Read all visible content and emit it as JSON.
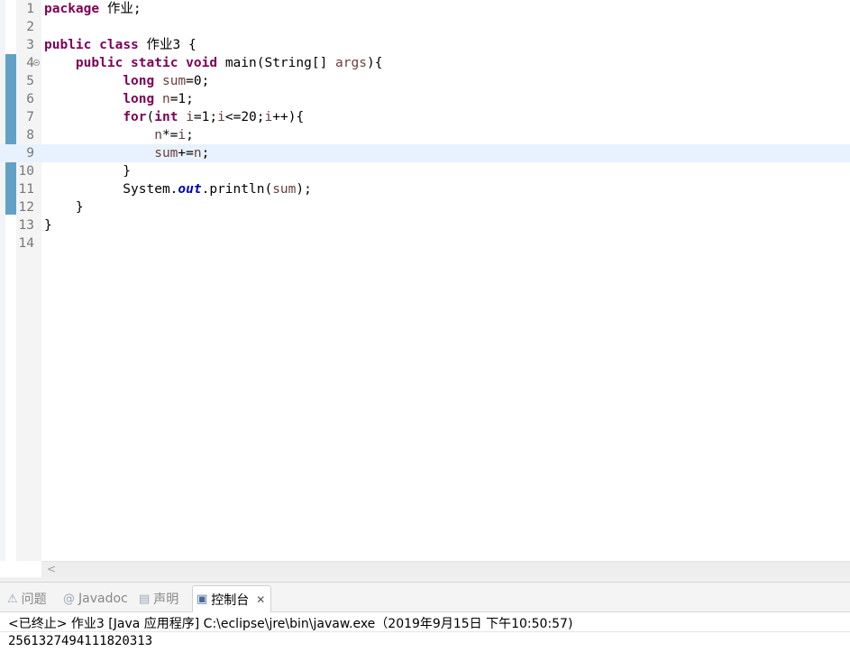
{
  "editor": {
    "current_line": 9,
    "lines": [
      {
        "n": "1",
        "tokens": [
          {
            "t": "package",
            "c": "kw"
          },
          {
            "t": " "
          },
          {
            "t": "作业",
            "c": "cjk"
          },
          {
            "t": ";"
          }
        ]
      },
      {
        "n": "2",
        "tokens": []
      },
      {
        "n": "3",
        "tokens": [
          {
            "t": "public",
            "c": "kw"
          },
          {
            "t": " "
          },
          {
            "t": "class",
            "c": "kw"
          },
          {
            "t": " "
          },
          {
            "t": "作业",
            "c": "cjk"
          },
          {
            "t": "3 {"
          }
        ]
      },
      {
        "n": "4",
        "fold": true,
        "tokens": [
          {
            "t": "    "
          },
          {
            "t": "public",
            "c": "kw"
          },
          {
            "t": " "
          },
          {
            "t": "static",
            "c": "kw"
          },
          {
            "t": " "
          },
          {
            "t": "void",
            "c": "kw"
          },
          {
            "t": " main(String[] "
          },
          {
            "t": "args",
            "c": "var"
          },
          {
            "t": "){"
          }
        ]
      },
      {
        "n": "5",
        "tokens": [
          {
            "t": "          "
          },
          {
            "t": "long",
            "c": "kw"
          },
          {
            "t": " "
          },
          {
            "t": "sum",
            "c": "var"
          },
          {
            "t": "=0;"
          }
        ]
      },
      {
        "n": "6",
        "tokens": [
          {
            "t": "          "
          },
          {
            "t": "long",
            "c": "kw"
          },
          {
            "t": " "
          },
          {
            "t": "n",
            "c": "var"
          },
          {
            "t": "=1;"
          }
        ]
      },
      {
        "n": "7",
        "tokens": [
          {
            "t": "          "
          },
          {
            "t": "for",
            "c": "kw"
          },
          {
            "t": "("
          },
          {
            "t": "int",
            "c": "kw"
          },
          {
            "t": " "
          },
          {
            "t": "i",
            "c": "var"
          },
          {
            "t": "=1;"
          },
          {
            "t": "i",
            "c": "var"
          },
          {
            "t": "<=20;"
          },
          {
            "t": "i",
            "c": "var"
          },
          {
            "t": "++){"
          }
        ]
      },
      {
        "n": "8",
        "tokens": [
          {
            "t": "              "
          },
          {
            "t": "n",
            "c": "var"
          },
          {
            "t": "*="
          },
          {
            "t": "i",
            "c": "var"
          },
          {
            "t": ";"
          }
        ]
      },
      {
        "n": "9",
        "tokens": [
          {
            "t": "              "
          },
          {
            "t": "sum",
            "c": "var"
          },
          {
            "t": "+="
          },
          {
            "t": "n",
            "c": "var"
          },
          {
            "t": ";"
          }
        ]
      },
      {
        "n": "10",
        "tokens": [
          {
            "t": "          }"
          }
        ]
      },
      {
        "n": "11",
        "tokens": [
          {
            "t": "          System."
          },
          {
            "t": "out",
            "c": "field"
          },
          {
            "t": ".println("
          },
          {
            "t": "sum",
            "c": "var"
          },
          {
            "t": ");"
          }
        ]
      },
      {
        "n": "12",
        "tokens": [
          {
            "t": "    }"
          }
        ]
      },
      {
        "n": "13",
        "tokens": [
          {
            "t": "}"
          }
        ]
      },
      {
        "n": "14",
        "tokens": []
      }
    ]
  },
  "hscroll": {
    "left_arrow": "<"
  },
  "views": {
    "tabs": [
      {
        "id": "problems",
        "label": "问题",
        "icon": "problems-icon",
        "glyph": "⚠",
        "active": false
      },
      {
        "id": "javadoc",
        "label": "Javadoc",
        "icon": "javadoc-icon",
        "glyph": "@",
        "active": false
      },
      {
        "id": "declaration",
        "label": "声明",
        "icon": "declaration-icon",
        "glyph": "▤",
        "active": false
      },
      {
        "id": "console",
        "label": "控制台",
        "icon": "console-icon",
        "glyph": "▣",
        "active": true,
        "close": "✕"
      }
    ]
  },
  "console": {
    "header": "<已终止> 作业3 [Java 应用程序] C:\\eclipse\\jre\\bin\\javaw.exe（2019年9月15日 下午10:50:57)",
    "output": "2561327494111820313"
  }
}
